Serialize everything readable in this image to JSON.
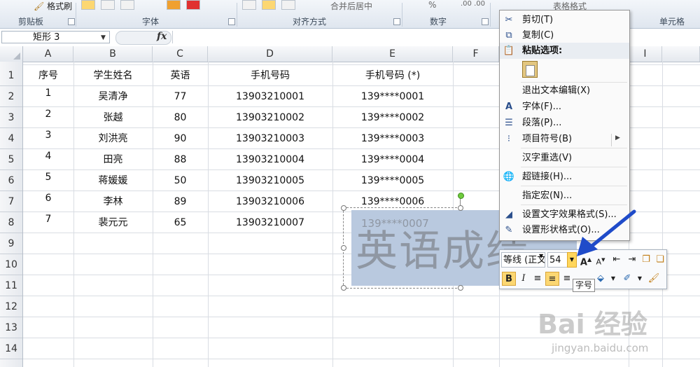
{
  "ribbon": {
    "format_painter": "格式刷",
    "groups": [
      "剪贴板",
      "字体",
      "对齐方式",
      "数字",
      "单元格"
    ],
    "table_format": "表格格式",
    "number_format_hint": "%",
    "decimal_hint": ".00 .00",
    "merge_hint": "合并后居中"
  },
  "formula_bar": {
    "name_box": "矩形 3",
    "fx": "fx"
  },
  "columns": [
    "A",
    "B",
    "C",
    "D",
    "E",
    "F",
    "I"
  ],
  "rows": [
    "1",
    "2",
    "3",
    "4",
    "5",
    "6",
    "7",
    "8",
    "9",
    "10",
    "11",
    "12",
    "13",
    "14"
  ],
  "table": {
    "headers": [
      "序号",
      "学生姓名",
      "英语",
      "手机号码",
      "手机号码 (*)"
    ],
    "rows": [
      [
        "1",
        "吴清净",
        "77",
        "13903210001",
        "139****0001"
      ],
      [
        "2",
        "张越",
        "80",
        "13903210002",
        "139****0002"
      ],
      [
        "3",
        "刘洪亮",
        "90",
        "13903210003",
        "139****0003"
      ],
      [
        "4",
        "田亮",
        "88",
        "13903210004",
        "139****0004"
      ],
      [
        "5",
        "蒋媛媛",
        "50",
        "13903210005",
        "139****0005"
      ],
      [
        "6",
        "李林",
        "89",
        "13903210006",
        "139****0006"
      ],
      [
        "7",
        "裴元元",
        "65",
        "13903210007",
        "139****0007"
      ]
    ]
  },
  "shape": {
    "text": "英语成绩"
  },
  "context_menu": {
    "items": [
      {
        "label": "剪切(T)",
        "icon": "scissors-icon"
      },
      {
        "label": "复制(C)",
        "icon": "copy-icon"
      },
      {
        "label": "粘贴选项:",
        "icon": "paste-icon"
      },
      {
        "label": "退出文本编辑(X)",
        "icon": ""
      },
      {
        "label": "字体(F)...",
        "icon": "font-icon"
      },
      {
        "label": "段落(P)...",
        "icon": "paragraph-icon"
      },
      {
        "label": "项目符号(B)",
        "icon": "bullets-icon"
      },
      {
        "label": "汉字重选(V)",
        "icon": ""
      },
      {
        "label": "超链接(H)...",
        "icon": "hyperlink-icon"
      },
      {
        "label": "指定宏(N)...",
        "icon": ""
      },
      {
        "label": "设置文字效果格式(S)...",
        "icon": "text-effects-icon"
      },
      {
        "label": "设置形状格式(O)...",
        "icon": "shape-format-icon"
      }
    ]
  },
  "mini_toolbar": {
    "font": "等线 (正文",
    "size": "54",
    "bold": "B",
    "italic": "I",
    "tooltip": "字号"
  },
  "watermark": {
    "brand": "Bai 经验",
    "url": "jingyan.baidu.com"
  }
}
